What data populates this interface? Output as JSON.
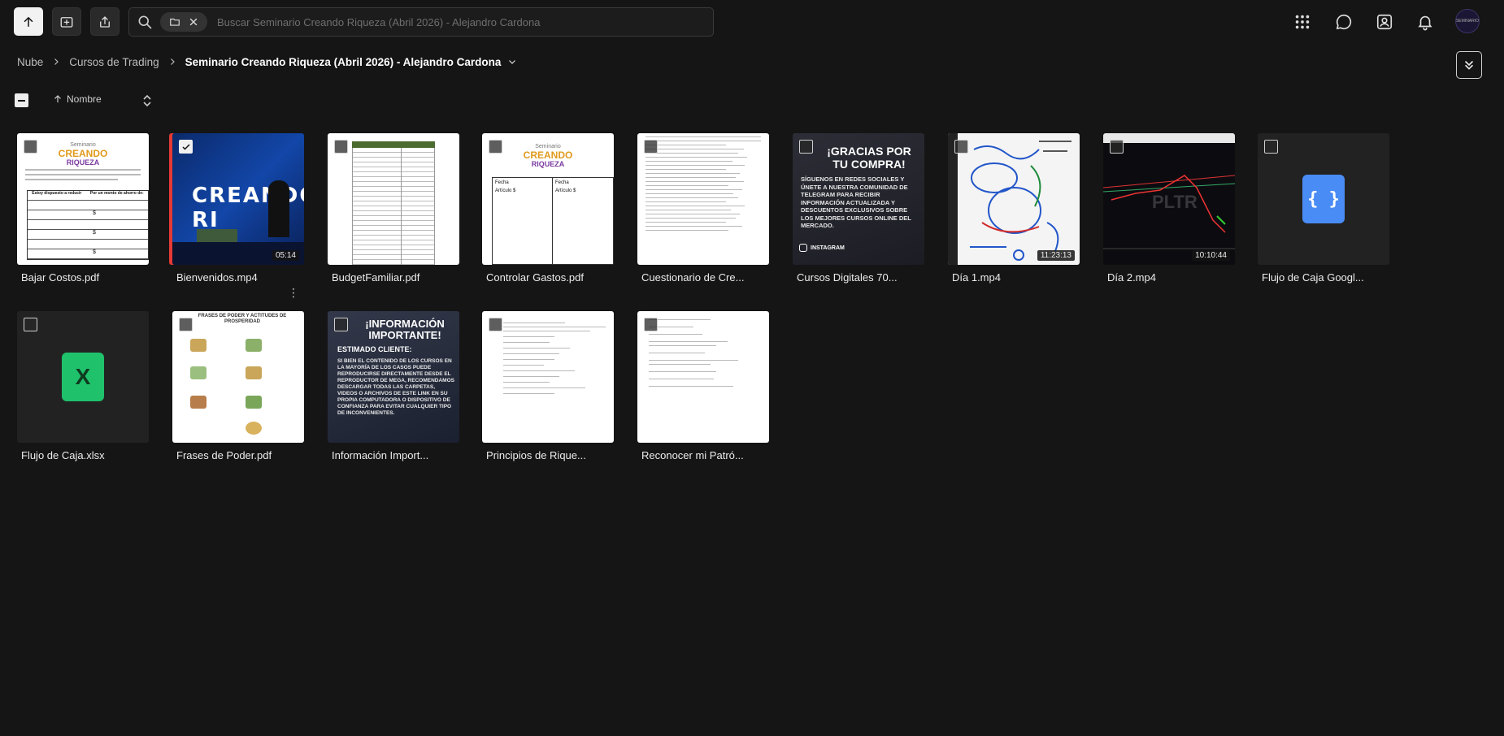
{
  "search": {
    "placeholder": "Buscar Seminario Creando Riqueza (Abril 2026) - Alejandro Cardona"
  },
  "breadcrumb": {
    "items": [
      "Nube",
      "Cursos de Trading"
    ],
    "current": "Seminario Creando Riqueza (Abril 2026) - Alejandro Cardona"
  },
  "sort": {
    "label": "Nombre"
  },
  "avatar": {
    "text": "SEMINARIO"
  },
  "files": [
    {
      "name": "Bajar Costos.pdf",
      "selected": false
    },
    {
      "name": "Bienvenidos.mp4",
      "selected": true,
      "duration": "05:14"
    },
    {
      "name": "BudgetFamiliar.pdf",
      "selected": false
    },
    {
      "name": "Controlar Gastos.pdf",
      "selected": false
    },
    {
      "name": "Cuestionario de Cre...",
      "selected": false
    },
    {
      "name": "Cursos Digitales 70...",
      "selected": false
    },
    {
      "name": "Día 1.mp4",
      "selected": false,
      "duration": "11:23:13"
    },
    {
      "name": "Día 2.mp4",
      "selected": false,
      "duration": "10:10:44"
    },
    {
      "name": "Flujo de Caja Googl...",
      "selected": false
    },
    {
      "name": "Flujo de Caja.xlsx",
      "selected": false
    },
    {
      "name": "Frases de Poder.pdf",
      "selected": false
    },
    {
      "name": "Información Import...",
      "selected": false
    },
    {
      "name": "Principios de Rique...",
      "selected": false
    },
    {
      "name": "Reconocer mi Patró...",
      "selected": false
    }
  ],
  "thumb_text": {
    "logo_small": "Seminario",
    "logo_big": "CREANDO",
    "logo_sub": "RIQUEZA",
    "video_title": "CREANDO RI",
    "gracias_title": "¡GRACIAS POR TU COMPRA!",
    "gracias_body": "SÍGUENOS EN REDES SOCIALES Y ÚNETE A NUESTRA COMUNIDAD DE TELEGRAM PARA RECIBIR INFORMACIÓN ACTUALIZADA Y DESCUENTOS EXCLUSIVOS SOBRE LOS MEJORES CURSOS ONLINE DEL MERCADO.",
    "instagram": "INSTAGRAM",
    "info_title": "¡INFORMACIÓN IMPORTANTE!",
    "info_sub": "ESTIMADO CLIENTE:",
    "info_body": "SI BIEN EL CONTENIDO DE LOS CURSOS EN LA MAYORÍA DE LOS CASOS PUEDE REPRODUCIRSE DIRECTAMENTE DESDE EL REPRODUCTOR DE MEGA, RECOMENDAMOS DESCARGAR TODAS LAS CARPETAS, VIDEOS O ARCHIVOS DE ESTE LINK EN SU PROPIA COMPUTADORA O DISPOSITIVO DE CONFIANZA PARA EVITAR CUALQUIER TIPO DE INCONVENIENTES.",
    "frases_title": "FRASES DE PODER Y ACTITUDES DE PROSPERIDAD",
    "fecha": "Fecha",
    "articulo": "Artículo $",
    "col_a": "Estoy dispuesto a reducir",
    "col_b": "Por un monto de ahorro de:",
    "dollar": "$",
    "gsheet_glyph": "{ }",
    "excel_glyph": "X",
    "chart_ticker": "PLTR"
  }
}
